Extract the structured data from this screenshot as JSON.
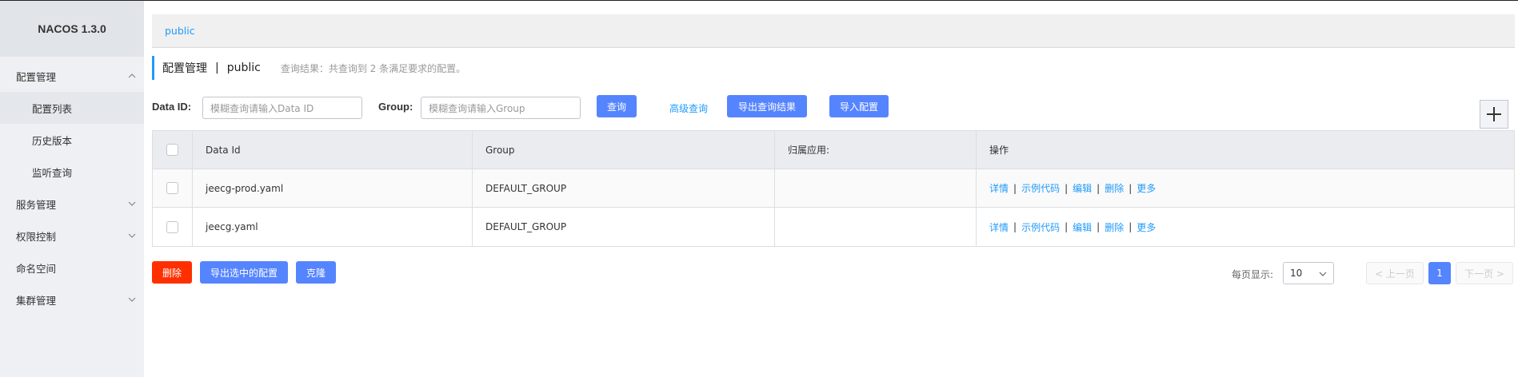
{
  "app": {
    "title": "NACOS 1.3.0"
  },
  "sidebar": {
    "groups": [
      {
        "label": "配置管理",
        "expanded": true,
        "items": [
          {
            "label": "配置列表",
            "active": true
          },
          {
            "label": "历史版本"
          },
          {
            "label": "监听查询"
          }
        ]
      },
      {
        "label": "服务管理"
      },
      {
        "label": "权限控制"
      },
      {
        "label": "命名空间"
      },
      {
        "label": "集群管理"
      }
    ]
  },
  "namespace_bar": {
    "current": "public"
  },
  "page": {
    "title": "配置管理",
    "separator": "|",
    "namespace": "public",
    "result_hint": "查询结果：共查询到 2 条满足要求的配置。"
  },
  "search": {
    "dataid_label": "Data ID:",
    "dataid_placeholder": "模糊查询请输入Data ID",
    "group_label": "Group:",
    "group_placeholder": "模糊查询请输入Group",
    "query_button": "查询",
    "advanced_link": "高级查询",
    "export_button": "导出查询结果",
    "import_button": "导入配置",
    "add_button": "+"
  },
  "table": {
    "columns": [
      "Data Id",
      "Group",
      "归属应用:",
      "操作"
    ],
    "rows": [
      {
        "data_id": "jeecg-prod.yaml",
        "group": "DEFAULT_GROUP",
        "app": ""
      },
      {
        "data_id": "jeecg.yaml",
        "group": "DEFAULT_GROUP",
        "app": ""
      }
    ],
    "actions": [
      "详情",
      "示例代码",
      "编辑",
      "删除",
      "更多"
    ]
  },
  "footer": {
    "delete_button": "删除",
    "export_selected_button": "导出选中的配置",
    "clone_button": "克隆",
    "page_size_label": "每页显示:",
    "page_size": "10",
    "prev": "< 上一页",
    "current_page": "1",
    "next": "下一页 >"
  },
  "colors": {
    "primary": "#5584ff",
    "danger": "#ff3000",
    "link": "#209bfa"
  }
}
